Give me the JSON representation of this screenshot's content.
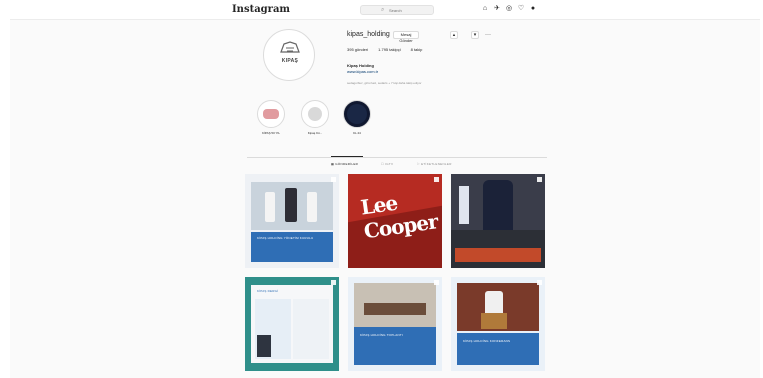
{
  "app": {
    "logo": "Instagram",
    "search_placeholder": "Search"
  },
  "colors": {
    "background": "#fafafa",
    "text": "#262626",
    "muted": "#8e8e8e",
    "border": "#dbdbdb",
    "link": "#00376b",
    "post_blue": "#2f6eb5"
  },
  "nav": {
    "icons": [
      "home-icon",
      "direct-icon",
      "explore-icon",
      "activity-icon",
      "profile-icon"
    ]
  },
  "profile": {
    "avatar_text": "KIPAŞ",
    "username": "kipas_holding",
    "buttons": {
      "message": "Mesaj Gönder",
      "follow": "▲",
      "suggest": "▾",
      "more": "···"
    },
    "stats": {
      "posts": "395 gönderi",
      "followers": "1.795 takipçi",
      "following": "8 takip"
    },
    "name": "Kipaş Holding",
    "link": "www.kipas.com.tr",
    "followed_by": "sedagurbuz, giris.haci, sedaris + 7 kişi daha takip ediyor"
  },
  "highlights": [
    {
      "label": "KİPAŞ 50 YIL"
    },
    {
      "label": "Kipaş Kü..."
    },
    {
      "label": "KL 24"
    }
  ],
  "tabs": {
    "posts": "▦ GÖNDERİLER",
    "tagged": "☐ IGTV",
    "igtv": "⚐ ETİKETLENENLER"
  },
  "posts": [
    {
      "caption": "KİPAŞ HOLDİNG YÖNETİM KURULU"
    },
    {
      "caption": "Lee Cooper"
    },
    {
      "caption": ""
    },
    {
      "caption": "KİPAŞ DERGİ"
    },
    {
      "caption": "KİPAŞ HOLDİNG TOPLANTI"
    },
    {
      "caption": "KİPAŞ HOLDİNG KONFERANS"
    }
  ]
}
